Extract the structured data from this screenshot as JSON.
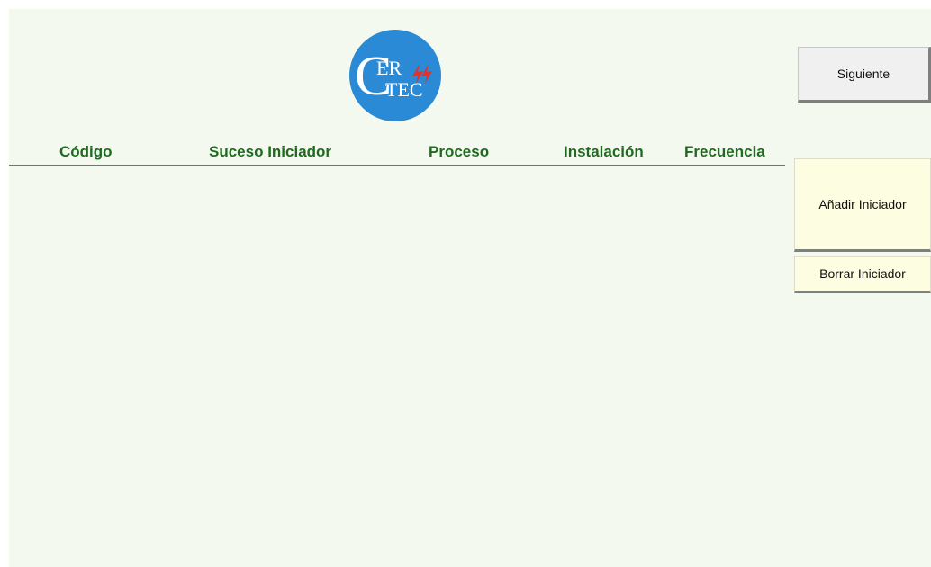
{
  "logo": {
    "line1": "ER",
    "line2": "TEC",
    "big_letter": "C",
    "circle_color": "#2a8ad6"
  },
  "table": {
    "columns": [
      "Código",
      "Suceso Iniciador",
      "Proceso",
      "Instalación",
      "Frecuencia"
    ]
  },
  "buttons": {
    "next_label": "Siguiente",
    "add_label": "Añadir Iniciador",
    "delete_label": "Borrar Iniciador"
  },
  "colors": {
    "background": "#f4f9ef",
    "header_text": "#1e6a1e",
    "header_line": "#3c9a3c",
    "add_delete_bg": "#fdfde2"
  }
}
